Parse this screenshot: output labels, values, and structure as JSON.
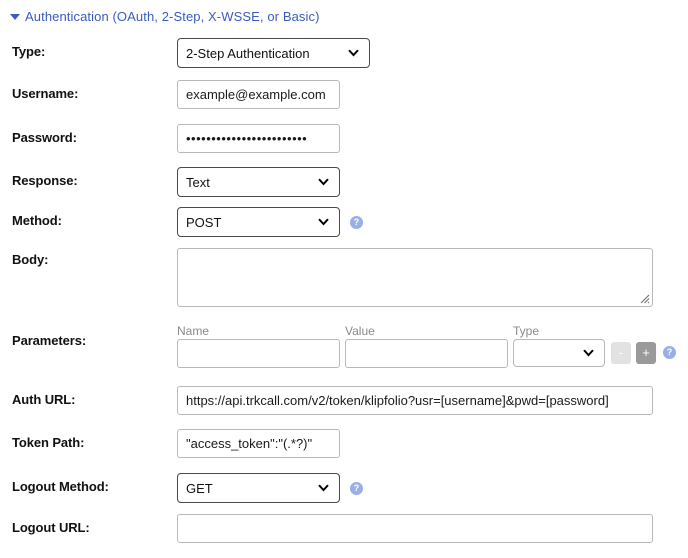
{
  "section": {
    "title": "Authentication (OAuth, 2-Step, X-WSSE, or Basic)",
    "disclosure_icon": "triangle-down-icon",
    "expanded": true,
    "link_color": "#3b5bbf"
  },
  "form": {
    "type": {
      "label": "Type:",
      "value": "2-Step Authentication",
      "control": "select"
    },
    "username": {
      "label": "Username:",
      "value": "example@example.com",
      "placeholder": "",
      "control": "text"
    },
    "password": {
      "label": "Password:",
      "value": "••••••••••••••••••••••••",
      "placeholder": "",
      "control": "password"
    },
    "response": {
      "label": "Response:",
      "value": "Text",
      "control": "select"
    },
    "method": {
      "label": "Method:",
      "value": "POST",
      "control": "select",
      "help": "?"
    },
    "body": {
      "label": "Body:",
      "value": "",
      "placeholder": "",
      "control": "textarea"
    },
    "parameters": {
      "label": "Parameters:",
      "columns": {
        "name": "Name",
        "value": "Value",
        "type": "Type"
      },
      "rows": [
        {
          "name": "",
          "value": "",
          "type": ""
        }
      ],
      "remove_button": "-",
      "add_button": "+",
      "help": "?"
    },
    "auth_url": {
      "label": "Auth URL:",
      "value": "https://api.trkcall.com/v2/token/klipfolio?usr=[username]&pwd=[password]",
      "placeholder": "",
      "control": "text"
    },
    "token_path": {
      "label": "Token Path:",
      "value": "\"access_token\":\"(.*?)\"",
      "placeholder": "",
      "control": "text"
    },
    "logout_method": {
      "label": "Logout Method:",
      "value": "GET",
      "control": "select",
      "help": "?"
    },
    "logout_url": {
      "label": "Logout URL:",
      "value": "",
      "placeholder": "",
      "control": "text"
    }
  },
  "icons": {
    "help": "help-circle-icon",
    "chevron": "chevron-down-icon",
    "resize": "resize-grip-icon"
  }
}
